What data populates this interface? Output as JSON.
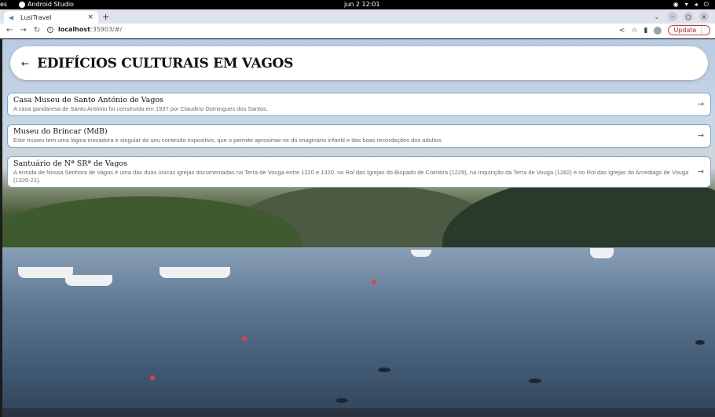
{
  "os": {
    "activities": "es",
    "app_name": "Android Studio",
    "clock": "jun 2  12:01"
  },
  "browser": {
    "tab_title": "LusiTravel",
    "url_host": "localhost",
    "url_rest": ":35903/#/",
    "update_label": "Update"
  },
  "page": {
    "title": "EDIFÍCIOS CULTURAIS EM VAGOS"
  },
  "items": [
    {
      "name": "Casa Museu de Santo António de Vagos",
      "description": "A casa gandaresa de Santo António foi construída em 1937 por Claudino Domingues dos Santos."
    },
    {
      "name": "Museu do Brincar (MdB)",
      "description": "Este museu tem uma lógica inovadora e singular do seu conteúdo expositivo, que o permite aproximar-se do imaginário infantil e das boas recordações dos adultos."
    },
    {
      "name": "Santuário de Nª SRª de Vagos",
      "description": "A ermida de Nossa Senhora de Vagos é uma das duas únicas igrejas documentadas na Terra de Vouga entre 1220 e 1320, no Rol das Igrejas do Bispado de Coimbra (1229), na Inquirição da Terra de Vouga (1282) e no Rol das Igrejas do Arcediago de Vouga (1320-21)."
    }
  ],
  "icons": {
    "back": "arrow-left-icon",
    "item_arrow": "arrow-right-icon"
  }
}
